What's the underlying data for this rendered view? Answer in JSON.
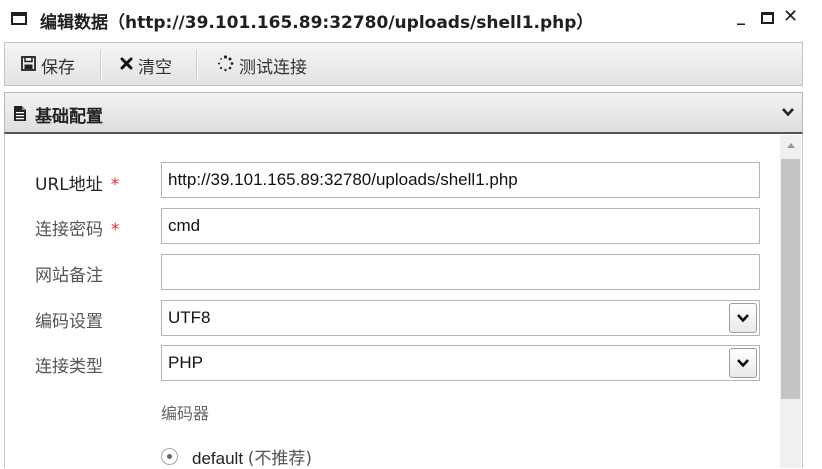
{
  "window": {
    "title": "编辑数据（http://39.101.165.89:32780/uploads/shell1.php）",
    "minimize": "_",
    "close": "✕"
  },
  "toolbar": {
    "save_label": "保存",
    "clear_label": "清空",
    "test_label": "测试连接"
  },
  "panel": {
    "title": "基础配置"
  },
  "form": {
    "required_mark": "*",
    "url": {
      "label": "URL地址",
      "value": "http://39.101.165.89:32780/uploads/shell1.php"
    },
    "password": {
      "label": "连接密码",
      "value": "cmd"
    },
    "note": {
      "label": "网站备注",
      "value": ""
    },
    "encoding": {
      "label": "编码设置",
      "value": "UTF8"
    },
    "conn_type": {
      "label": "连接类型",
      "value": "PHP"
    },
    "encoder": {
      "heading": "编码器",
      "option": "default",
      "option_note": "(不推荐)"
    }
  },
  "icons": {
    "window": "window-icon",
    "save": "floppy-disk-icon",
    "clear": "x-icon",
    "test": "spinner-icon",
    "panel": "document-icon",
    "collapse": "chevron-down-icon"
  },
  "colors": {
    "required": "#e0312f",
    "border": "#b5b5b5",
    "header_bg": "#e6e6e6"
  }
}
